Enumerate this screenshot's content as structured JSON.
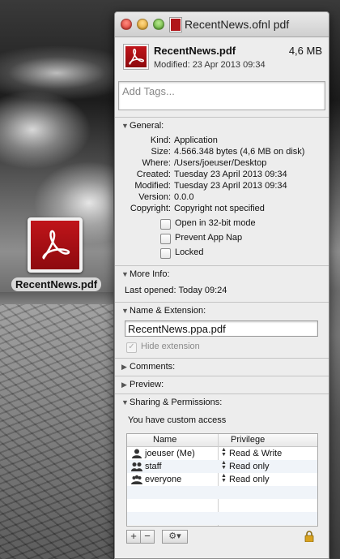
{
  "desktop": {
    "file_label": "RecentNews.pdf"
  },
  "window": {
    "title": "RecentNews.ofnl pdf"
  },
  "header": {
    "name": "RecentNews.pdf",
    "size": "4,6 MB",
    "modified": "Modified: 23 Apr 2013 09:34"
  },
  "tags": {
    "placeholder": "Add Tags..."
  },
  "general": {
    "title": "General:",
    "rows": [
      {
        "label": "Kind:",
        "value": "Application"
      },
      {
        "label": "Size:",
        "value": "4.566.348 bytes (4,6 MB on disk)"
      },
      {
        "label": "Where:",
        "value": "/Users/joeuser/Desktop"
      },
      {
        "label": "Created:",
        "value": "Tuesday 23 April 2013 09:34"
      },
      {
        "label": "Modified:",
        "value": "Tuesday 23 April 2013 09:34"
      },
      {
        "label": "Version:",
        "value": "0.0.0"
      },
      {
        "label": "Copyright:",
        "value": "Copyright not specified"
      }
    ],
    "checkboxes": [
      {
        "label": "Open in 32-bit mode",
        "checked": false
      },
      {
        "label": "Prevent App Nap",
        "checked": false
      },
      {
        "label": "Locked",
        "checked": false
      }
    ]
  },
  "more_info": {
    "title": "More Info:",
    "last_opened": "Last opened: Today 09:24"
  },
  "name_ext": {
    "title": "Name & Extension:",
    "value": "RecentNews.ppa.pdf",
    "hide_label": "Hide extension",
    "hide_checked": true
  },
  "comments": {
    "title": "Comments:"
  },
  "preview": {
    "title": "Preview:"
  },
  "sharing": {
    "title": "Sharing & Permissions:",
    "note": "You have custom access",
    "col_name": "Name",
    "col_privilege": "Privilege",
    "rows": [
      {
        "name": "joeuser (Me)",
        "privilege": "Read & Write",
        "icon": "user-icon"
      },
      {
        "name": "staff",
        "privilege": "Read only",
        "icon": "group-icon"
      },
      {
        "name": "everyone",
        "privilege": "Read only",
        "icon": "everyone-icon"
      }
    ],
    "add": "+",
    "remove": "−",
    "action": "⚙▾"
  },
  "colors": {
    "pdf_red": "#b0161a",
    "lock": "#d9a21e"
  }
}
